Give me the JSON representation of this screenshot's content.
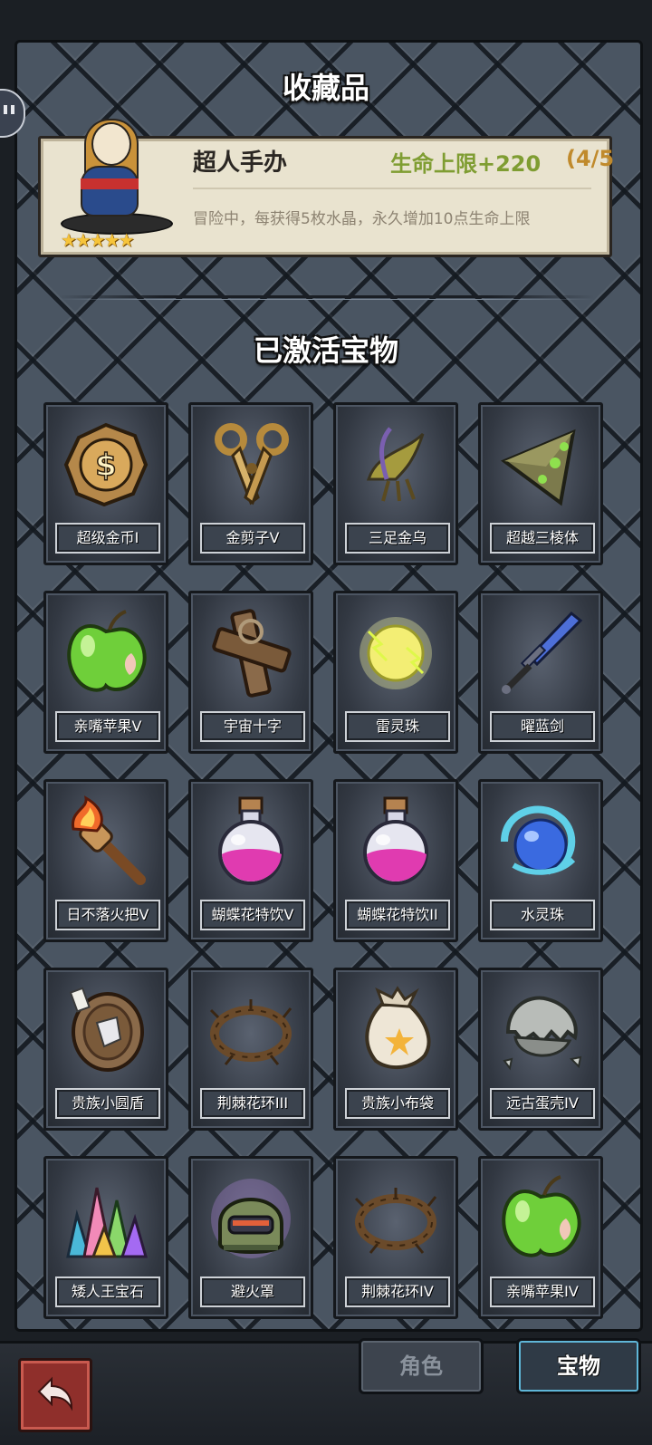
{
  "header": {
    "collection_title": "收藏品"
  },
  "featured": {
    "name": "超人手办",
    "stat": "生命上限+220",
    "progress": "(4/5",
    "description": "冒险中，每获得5枚水晶，永久增加10点生命上限",
    "stars": "★★★★★",
    "star_count": 5
  },
  "section": {
    "title": "已激活宝物"
  },
  "items": [
    {
      "label": "超级金币I",
      "icon": "gold-coin-icon"
    },
    {
      "label": "金剪子V",
      "icon": "golden-scissors-icon"
    },
    {
      "label": "三足金乌",
      "icon": "golden-crow-icon"
    },
    {
      "label": "超越三棱体",
      "icon": "prism-icon"
    },
    {
      "label": "亲嘴苹果V",
      "icon": "green-apple-icon"
    },
    {
      "label": "宇宙十字",
      "icon": "wooden-cross-icon"
    },
    {
      "label": "雷灵珠",
      "icon": "thunder-orb-icon"
    },
    {
      "label": "曜蓝剑",
      "icon": "blue-sword-icon"
    },
    {
      "label": "日不落火把V",
      "icon": "torch-icon"
    },
    {
      "label": "蝴蝶花特饮V",
      "icon": "potion-icon"
    },
    {
      "label": "蝴蝶花特饮II",
      "icon": "potion-icon"
    },
    {
      "label": "水灵珠",
      "icon": "water-orb-icon"
    },
    {
      "label": "贵族小圆盾",
      "icon": "round-shield-icon"
    },
    {
      "label": "荆棘花环III",
      "icon": "thorn-wreath-icon"
    },
    {
      "label": "贵族小布袋",
      "icon": "cloth-bag-icon"
    },
    {
      "label": "远古蛋壳IV",
      "icon": "eggshell-icon"
    },
    {
      "label": "矮人王宝石",
      "icon": "gem-cluster-icon"
    },
    {
      "label": "避火罩",
      "icon": "fire-mask-icon"
    },
    {
      "label": "荆棘花环IV",
      "icon": "thorn-wreath-icon"
    },
    {
      "label": "亲嘴苹果IV",
      "icon": "green-apple-icon"
    }
  ],
  "bottom": {
    "tab_role": "角色",
    "tab_treasure": "宝物",
    "back_icon": "back-arrow-icon"
  },
  "colors": {
    "stat_green": "#7f9d32",
    "progress_gold": "#c08a2c",
    "back_red": "#8f2f2b",
    "active_tab_glow": "#5fb6d8"
  }
}
